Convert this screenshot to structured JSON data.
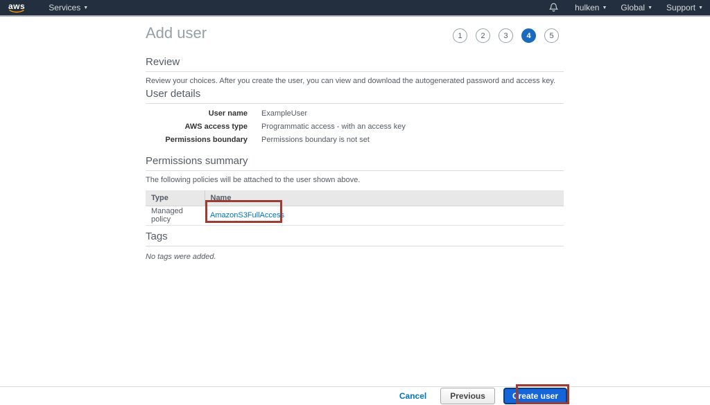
{
  "topnav": {
    "logo_text": "aws",
    "services_label": "Services",
    "user_label": "hulken",
    "region_label": "Global",
    "support_label": "Support"
  },
  "header": {
    "title": "Add user",
    "steps": [
      "1",
      "2",
      "3",
      "4",
      "5"
    ],
    "active_step": "4"
  },
  "review": {
    "heading": "Review",
    "description": "Review your choices. After you create the user, you can view and download the autogenerated password and access key."
  },
  "user_details": {
    "heading": "User details",
    "rows": [
      {
        "label": "User name",
        "value": "ExampleUser"
      },
      {
        "label": "AWS access type",
        "value": "Programmatic access - with an access key"
      },
      {
        "label": "Permissions boundary",
        "value": "Permissions boundary is not set"
      }
    ]
  },
  "permissions_summary": {
    "heading": "Permissions summary",
    "description": "The following policies will be attached to the user shown above.",
    "table": {
      "columns": {
        "type": "Type",
        "name": "Name"
      },
      "rows": [
        {
          "type": "Managed policy",
          "name": "AmazonS3FullAccess"
        }
      ]
    }
  },
  "tags": {
    "heading": "Tags",
    "empty_text": "No tags were added."
  },
  "footer": {
    "cancel_label": "Cancel",
    "previous_label": "Previous",
    "create_label": "Create user"
  },
  "colors": {
    "navbar_bg": "#232f3e",
    "link_blue": "#0073bb",
    "active_step_blue": "#1a6bbc",
    "primary_button_blue": "#1565d8",
    "annotation_red": "#9d3c32",
    "aws_smile_orange": "#f90"
  }
}
